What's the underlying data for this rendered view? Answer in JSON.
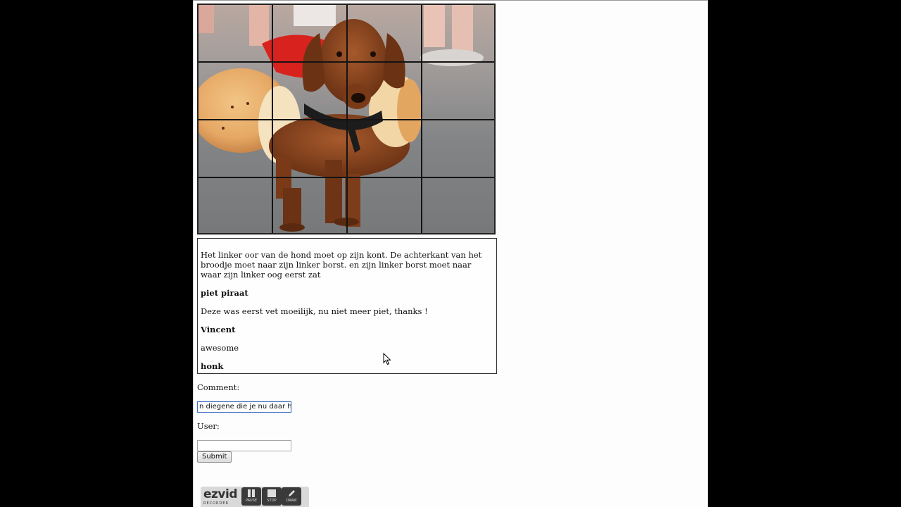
{
  "comments": [
    {
      "text": "Het linker oor van de hond moet op zijn kont. De achterkant van het broodje moet naar zijn linker borst. en zijn linker borst moet naar waar zijn linker oog eerst zat",
      "user": "piet piraat"
    },
    {
      "text": "Deze was eerst vet moeilijk, nu niet meer piet, thanks !",
      "user": "Vincent"
    },
    {
      "text": "awesome",
      "user": "honk"
    }
  ],
  "form": {
    "comment_label": "Comment:",
    "comment_value": "n diegene die je nu daar hebt",
    "user_label": "User:",
    "user_value": "",
    "submit_label": "Submit"
  },
  "recorder": {
    "logo": "ezvid",
    "logo_sub": "RECORDER",
    "pause_label": "PAUSE",
    "stop_label": "STOP",
    "draw_label": "DRAW"
  }
}
